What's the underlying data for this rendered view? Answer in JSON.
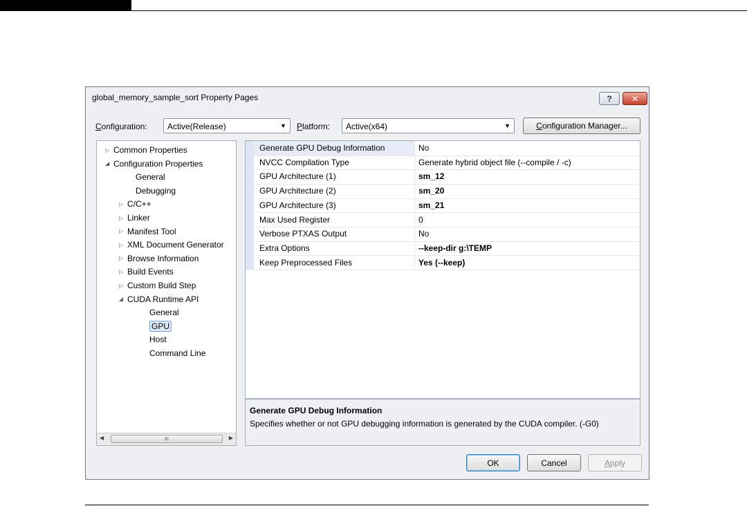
{
  "dialog": {
    "title": "global_memory_sample_sort Property Pages",
    "help_label": "?",
    "close_label": "✕"
  },
  "config": {
    "configuration_label": "Configuration:",
    "configuration_value": "Active(Release)",
    "platform_label": "Platform:",
    "platform_value": "Active(x64)",
    "manager_button": "Configuration Manager..."
  },
  "tree": {
    "items": [
      {
        "label": "Common Properties",
        "toggle": "▷"
      },
      {
        "label": "Configuration Properties",
        "toggle": "◢"
      },
      {
        "label": "General",
        "toggle": ""
      },
      {
        "label": "Debugging",
        "toggle": ""
      },
      {
        "label": "C/C++",
        "toggle": "▷"
      },
      {
        "label": "Linker",
        "toggle": "▷"
      },
      {
        "label": "Manifest Tool",
        "toggle": "▷"
      },
      {
        "label": "XML Document Generator",
        "toggle": "▷"
      },
      {
        "label": "Browse Information",
        "toggle": "▷"
      },
      {
        "label": "Build Events",
        "toggle": "▷"
      },
      {
        "label": "Custom Build Step",
        "toggle": "▷"
      },
      {
        "label": "CUDA Runtime API",
        "toggle": "◢"
      },
      {
        "label": "General",
        "toggle": ""
      },
      {
        "label": "GPU",
        "toggle": "",
        "selected": true
      },
      {
        "label": "Host",
        "toggle": ""
      },
      {
        "label": "Command Line",
        "toggle": ""
      }
    ],
    "scroll_left": "◀",
    "scroll_right": "▶",
    "scroll_grip": "III"
  },
  "properties": {
    "rows": [
      {
        "name": "Generate GPU Debug Information",
        "value": "No",
        "bold": false,
        "selected": true
      },
      {
        "name": "NVCC Compilation Type",
        "value": "Generate hybrid object file  (--compile / -c)",
        "bold": false
      },
      {
        "name": "GPU Architecture (1)",
        "value": "sm_12",
        "bold": true
      },
      {
        "name": "GPU Architecture (2)",
        "value": "sm_20",
        "bold": true
      },
      {
        "name": "GPU Architecture (3)",
        "value": "sm_21",
        "bold": true
      },
      {
        "name": "Max Used Register",
        "value": "0",
        "bold": false
      },
      {
        "name": "Verbose PTXAS Output",
        "value": "No",
        "bold": false
      },
      {
        "name": "Extra Options",
        "value": "--keep-dir g:\\TEMP",
        "bold": true
      },
      {
        "name": "Keep Preprocessed Files",
        "value": "Yes (--keep)",
        "bold": true
      }
    ]
  },
  "description": {
    "title": "Generate GPU Debug Information",
    "text": "Specifies whether or not GPU debugging information is generated by the CUDA compiler.  (-G0)"
  },
  "buttons": {
    "ok": "OK",
    "cancel": "Cancel",
    "apply": "Apply"
  }
}
